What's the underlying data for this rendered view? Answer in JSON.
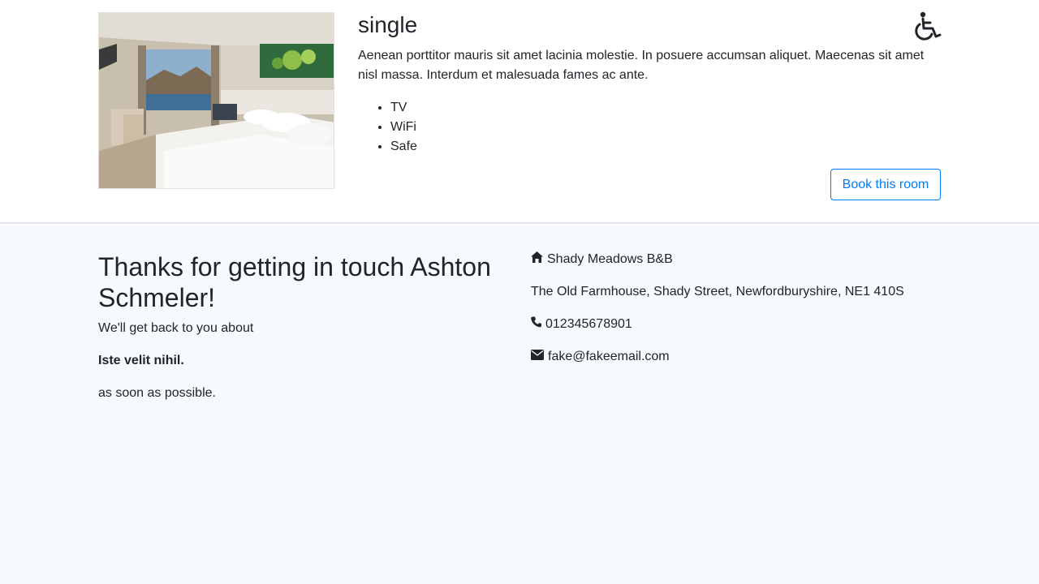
{
  "room": {
    "title": "single",
    "description": "Aenean porttitor mauris sit amet lacinia molestie. In posuere accumsan aliquet. Maecenas sit amet nisl massa. Interdum et malesuada fames ac ante.",
    "features": [
      "TV",
      "WiFi",
      "Safe"
    ],
    "book_label": "Book this room",
    "accessible_icon": "wheelchair-icon",
    "image_icon": "room-photo"
  },
  "contact_confirmation": {
    "heading": "Thanks for getting in touch Ashton Schmeler!",
    "intro": "We'll get back to you about",
    "subject": "Iste velit nihil.",
    "outro": "as soon as possible."
  },
  "business": {
    "name": "Shady Meadows B&B",
    "address": "The Old Farmhouse, Shady Street, Newfordburyshire, NE1 410S",
    "phone": "012345678901",
    "email": "fake@fakeemail.com",
    "icons": [
      "home-icon",
      "phone-icon",
      "envelope-icon"
    ]
  },
  "colors": {
    "primary": "#007bff",
    "text": "#212529",
    "contact_bg": "#f6f9fd"
  }
}
